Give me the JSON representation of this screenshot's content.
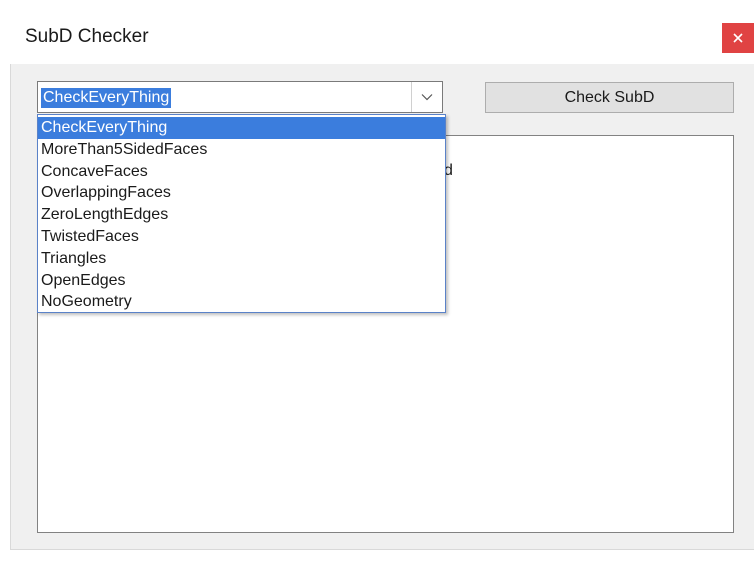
{
  "window": {
    "title": "SubD Checker"
  },
  "combo": {
    "selected": "CheckEveryThing",
    "options": [
      "CheckEveryThing",
      "MoreThan5SidedFaces",
      "ConcaveFaces",
      "OverlappingFaces",
      "ZeroLengthEdges",
      "TwistedFaces",
      "Triangles",
      "OpenEdges",
      "NoGeometry"
    ]
  },
  "toolbar": {
    "check_label": "Check SubD"
  },
  "output": {
    "partial_text": "d"
  },
  "colors": {
    "selection": "#3b7ddd",
    "close": "#e04343"
  }
}
